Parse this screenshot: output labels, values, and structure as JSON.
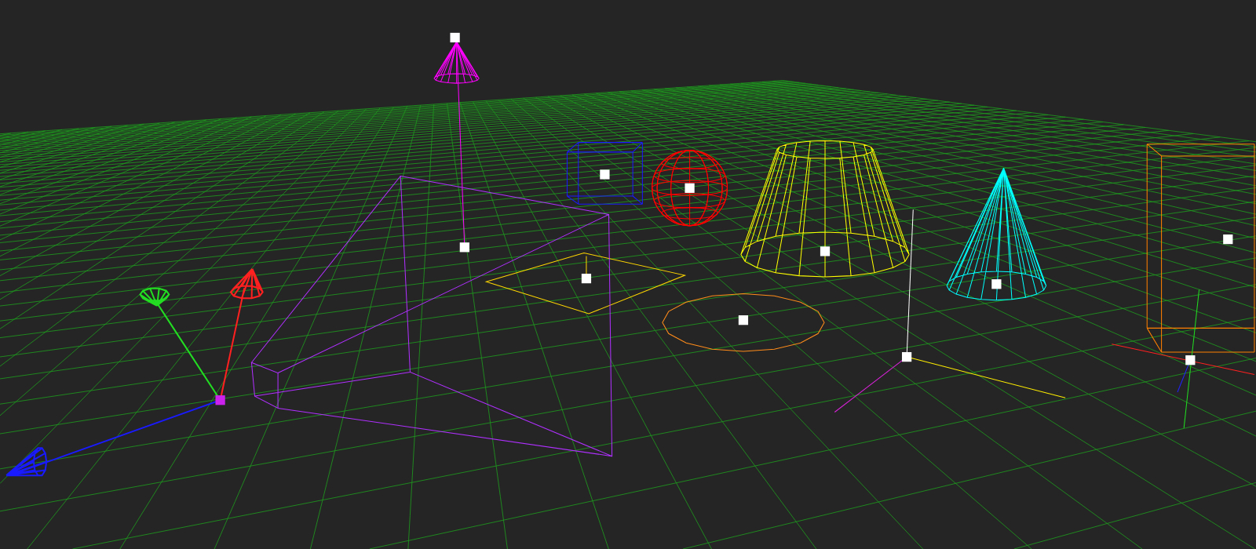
{
  "scene": {
    "objects": [
      {
        "kind": "spotlight",
        "color": "#ff00ff",
        "selected": false
      },
      {
        "kind": "box",
        "color": "#1a1aff",
        "selected": false
      },
      {
        "kind": "sphere",
        "color": "#ff0000",
        "selected": false
      },
      {
        "kind": "frustum",
        "color": "#ffff00",
        "selected": false
      },
      {
        "kind": "cone",
        "color": "#00ffff",
        "selected": false
      },
      {
        "kind": "box",
        "color": "#ff8000",
        "selected": false
      },
      {
        "kind": "plane",
        "color": "#ffd700",
        "selected": false
      },
      {
        "kind": "ring",
        "color": "#ff8c1a",
        "selected": false
      },
      {
        "kind": "camera-frustum",
        "color": "#b030ff",
        "selected": false
      },
      {
        "kind": "gizmo",
        "selected": true
      },
      {
        "kind": "axes",
        "selected": false
      },
      {
        "kind": "axes",
        "selected": false
      }
    ]
  }
}
